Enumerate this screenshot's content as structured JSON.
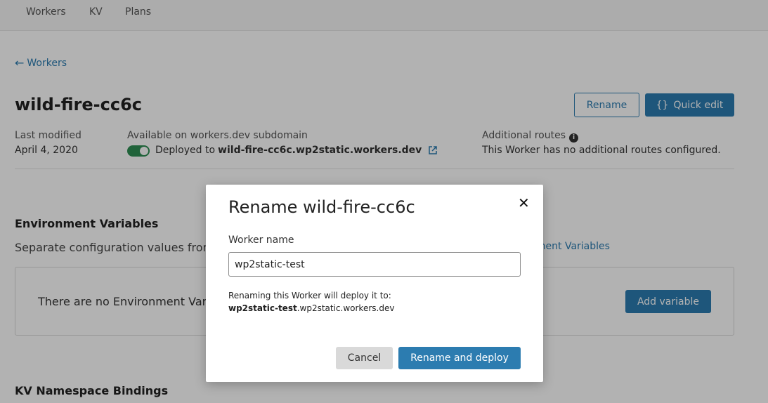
{
  "nav": {
    "items": [
      "Workers",
      "KV",
      "Plans"
    ]
  },
  "back_link": "Workers",
  "worker": {
    "title": "wild-fire-cc6c",
    "rename_label": "Rename",
    "quick_edit_label": "Quick edit",
    "quick_edit_glyph": "{}",
    "last_modified_label": "Last modified",
    "last_modified_value": "April 4, 2020",
    "subdomain_label": "Available on workers.dev subdomain",
    "deployed_prefix": "Deployed to",
    "deployed_url": "wild-fire-cc6c.wp2static.workers.dev",
    "subdomain_toggle_on": true,
    "routes_label": "Additional routes",
    "routes_value": "This Worker has no additional routes configured."
  },
  "env": {
    "title": "Environment Variables",
    "desc": "Separate configuration values fron",
    "link": "ronment Variables",
    "empty_text": "There are no Environment Var",
    "add_label": "Add variable"
  },
  "kv": {
    "title": "KV Namespace Bindings"
  },
  "modal": {
    "title": "Rename wild-fire-cc6c",
    "close_glyph": "✕",
    "field_label": "Worker name",
    "input_value": "wp2static-test",
    "note_line1": "Renaming this Worker will deploy it to:",
    "note_name": "wp2static-test",
    "note_domain": ".wp2static.workers.dev",
    "cancel_label": "Cancel",
    "confirm_label": "Rename and deploy"
  },
  "colors": {
    "accent": "#2c7cb0",
    "toggle_on": "#2f8f54"
  }
}
